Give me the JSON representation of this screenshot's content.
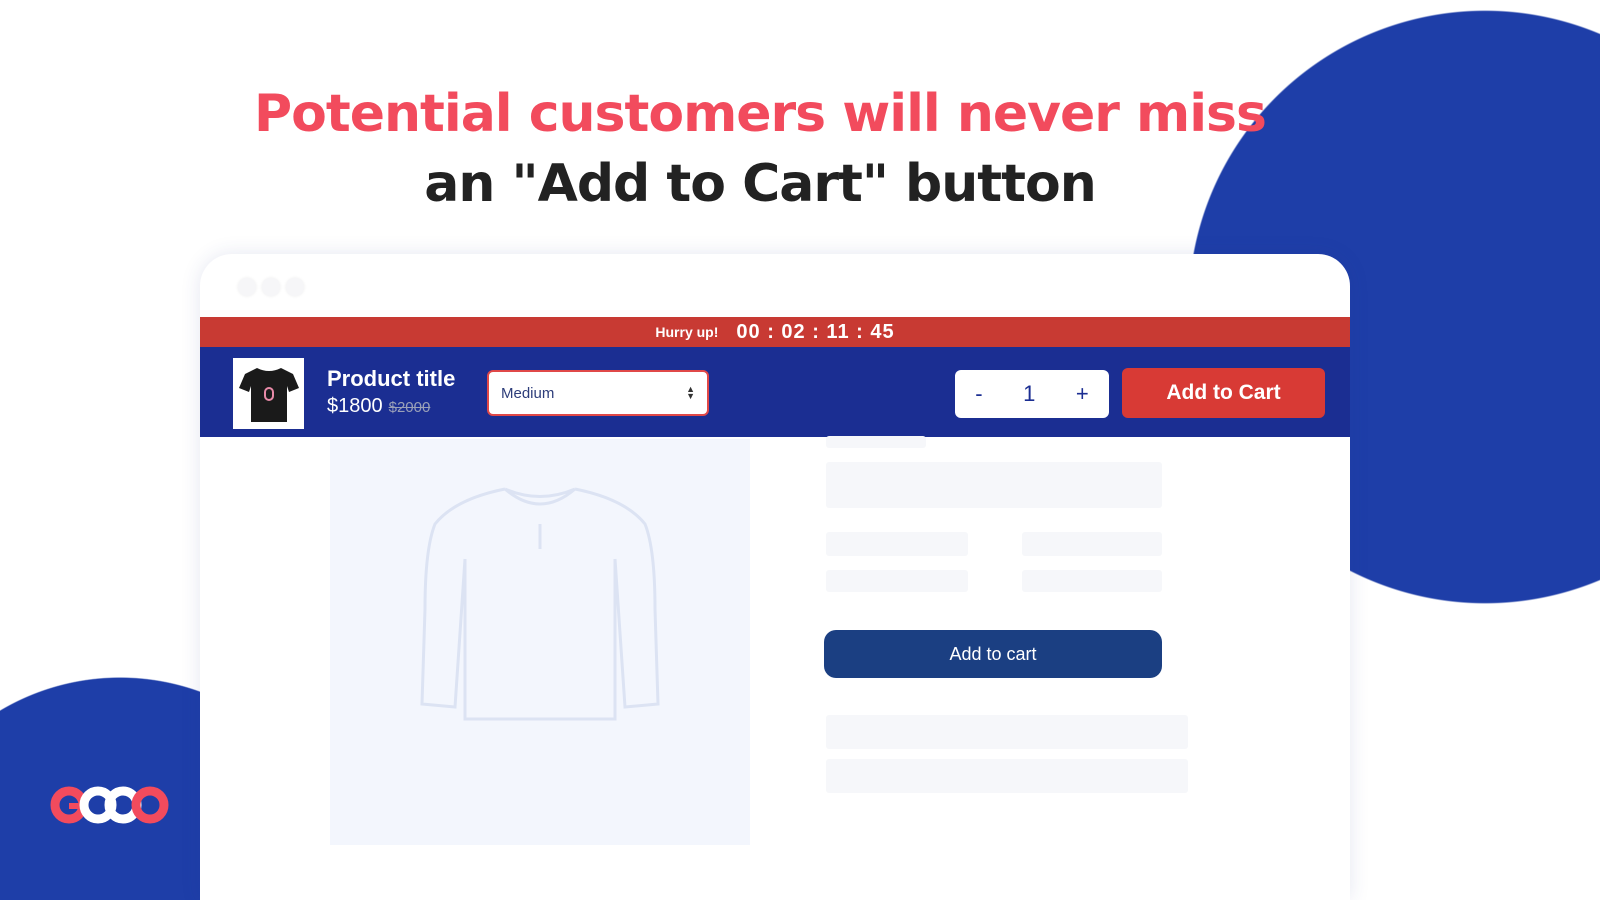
{
  "headline": {
    "line1": "Potential customers will never miss",
    "line2": "an \"Add to Cart\" button"
  },
  "sticky_bar": {
    "hurry_label": "Hurry up!",
    "countdown": "00 : 02 : 11 : 45",
    "product_title": "Product title",
    "price": "$1800",
    "compare_price": "$2000",
    "variant_selected": "Medium",
    "quantity": "1",
    "minus": "-",
    "plus": "+",
    "add_to_cart": "Add to Cart"
  },
  "page": {
    "add_to_cart": "Add to cart"
  },
  "logo": {
    "text": "GOOO"
  },
  "colors": {
    "accent_red": "#f24b5d",
    "bar_red": "#c83a33",
    "bar_blue": "#1b2e92",
    "circle_blue": "#1e3ea8",
    "button_navy": "#1b3f82"
  }
}
